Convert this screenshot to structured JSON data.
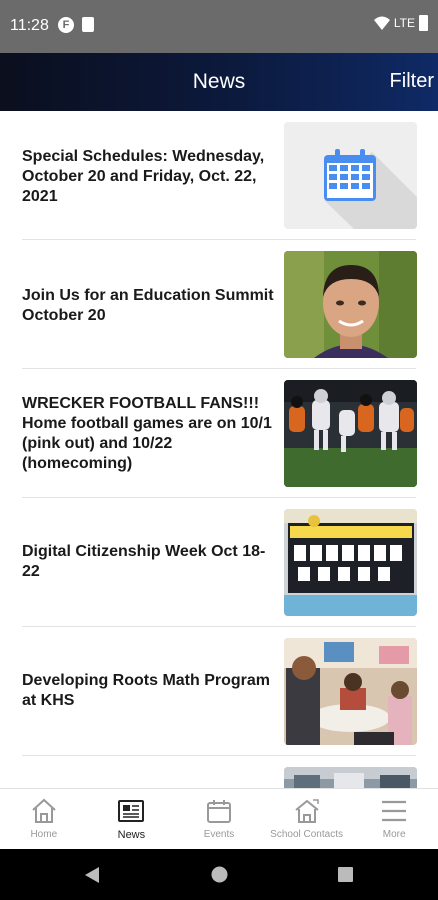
{
  "status_bar": {
    "time": "11:28",
    "notif_icon_letter": "F",
    "network": "LTE"
  },
  "header": {
    "title": "News",
    "filter_label": "Filter"
  },
  "news": [
    {
      "title": "Special Schedules: Wednesday, October 20 and Friday, Oct. 22, 2021",
      "thumb": "calendar-icon"
    },
    {
      "title": "Join Us for an Education Summit October 20",
      "thumb": "portrait-photo"
    },
    {
      "title": "WRECKER FOOTBALL FANS!!! Home football games are on 10/1 (pink out) and 10/22 (homecoming)",
      "thumb": "football-photo"
    },
    {
      "title": "Digital Citizenship Week Oct 18-22",
      "thumb": "bulletin-board-photo"
    },
    {
      "title": "Developing Roots Math Program at KHS",
      "thumb": "classroom-photo"
    }
  ],
  "bottom_nav": [
    {
      "label": "Home",
      "icon": "home-icon"
    },
    {
      "label": "News",
      "icon": "news-icon",
      "active": true
    },
    {
      "label": "Events",
      "icon": "calendar-icon"
    },
    {
      "label": "School Contacts",
      "icon": "school-contacts-icon"
    },
    {
      "label": "More",
      "icon": "menu-icon"
    }
  ],
  "colors": {
    "header_dark": "#0b0f1e",
    "header_blue": "#0f2a66",
    "calendar_blue": "#4a8df0",
    "status_bar": "#6b6b6b"
  }
}
